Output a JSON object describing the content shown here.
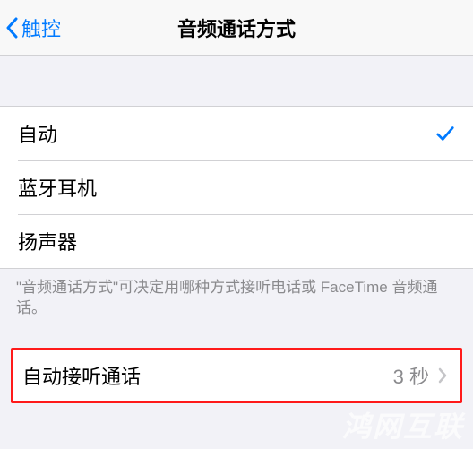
{
  "nav": {
    "back_label": "触控",
    "title": "音频通话方式"
  },
  "options": {
    "items": [
      {
        "label": "自动",
        "selected": true
      },
      {
        "label": "蓝牙耳机",
        "selected": false
      },
      {
        "label": "扬声器",
        "selected": false
      }
    ],
    "footer": "\"音频通话方式\"可决定用哪种方式接听电话或 FaceTime 音频通话。"
  },
  "auto_answer": {
    "label": "自动接听通话",
    "value": "3 秒"
  },
  "watermark": "鸿网互联"
}
